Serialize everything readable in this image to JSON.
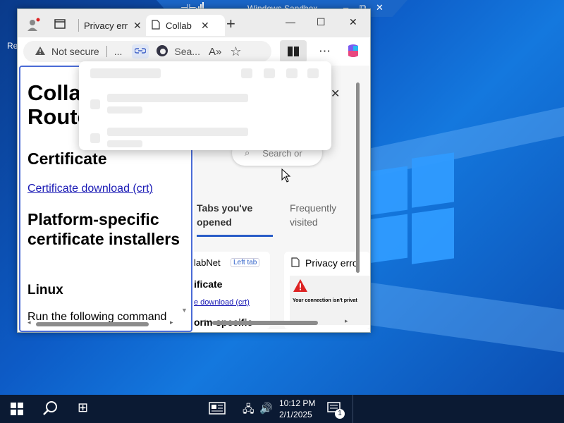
{
  "desktop": {
    "recycle_label": "Re",
    "colors": {
      "accent": "#1478de",
      "taskbar": "#0b1a33"
    }
  },
  "sandbox": {
    "title": "Windows Sandbox",
    "icons": [
      "pin-icon",
      "signal-icon",
      "minimize-icon",
      "restore-icon",
      "close-icon"
    ]
  },
  "browser": {
    "tabs": [
      {
        "label": "Privacy erro",
        "icon": "tab-actions-icon",
        "active": false
      },
      {
        "label": "Collab",
        "icon": "page-icon",
        "active": true
      }
    ],
    "new_tab": "+",
    "address": {
      "security": "Not secure",
      "ellipsis": "...",
      "search_text": "Sea..."
    },
    "window_controls": {
      "minimize": "—",
      "maximize": "☐",
      "close": "✕"
    }
  },
  "left_pane": {
    "title_line1": "Colla",
    "title_line2": "Route",
    "heading_certificate": "Certificate",
    "link_certificate": "Certificate download (crt)",
    "heading_platform": "Platform-specific certificate installers",
    "heading_linux": "Linux",
    "text_run": "Run the following command"
  },
  "right_pane": {
    "search_text": "Search or",
    "tab_opened": "Tabs you've opened",
    "tab_frequent": "Frequently visited",
    "card1": {
      "title": "labNet",
      "badge": "Left tab",
      "line1": "ificate",
      "line2": "e download (crt)",
      "line3": "orm-specific"
    },
    "card2": {
      "title": "Privacy erro",
      "warning": "Your connection isn't privat"
    }
  },
  "taskbar": {
    "time": "10:12 PM",
    "date": "2/1/2025",
    "notification_count": "1"
  }
}
